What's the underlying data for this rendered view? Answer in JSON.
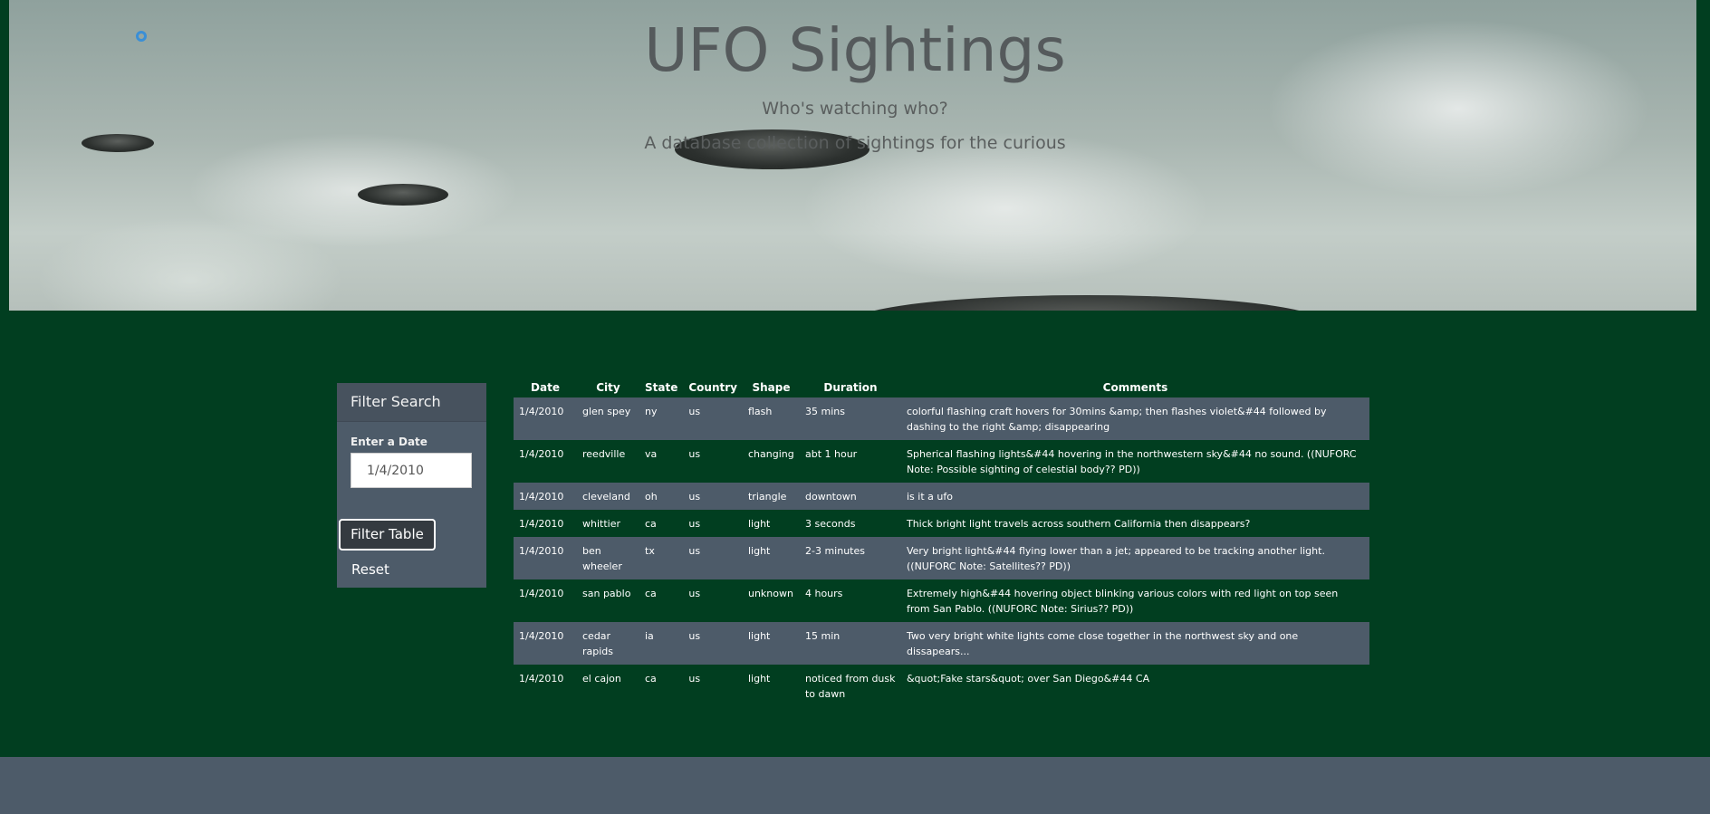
{
  "header": {
    "title": "UFO Sightings",
    "tagline": "Who's watching who?",
    "subtitle": "A database collection of sightings for the curious"
  },
  "filter": {
    "header": "Filter Search",
    "date_label": "Enter a Date",
    "date_placeholder": "1/4/2010",
    "date_value": "1/4/2010",
    "filter_button": "Filter Table",
    "reset_button": "Reset"
  },
  "table": {
    "columns": [
      "Date",
      "City",
      "State",
      "Country",
      "Shape",
      "Duration",
      "Comments"
    ],
    "rows": [
      [
        "1/4/2010",
        "glen spey",
        "ny",
        "us",
        "flash",
        "35 mins",
        "colorful flashing craft hovers for 30mins &amp; then flashes violet&#44 followed by dashing to the right &amp; disappearing"
      ],
      [
        "1/4/2010",
        "reedville",
        "va",
        "us",
        "changing",
        "abt 1 hour",
        "Spherical flashing lights&#44 hovering in the northwestern sky&#44 no sound. ((NUFORC Note: Possible sighting of celestial body?? PD))"
      ],
      [
        "1/4/2010",
        "cleveland",
        "oh",
        "us",
        "triangle",
        "downtown",
        "is it a ufo"
      ],
      [
        "1/4/2010",
        "whittier",
        "ca",
        "us",
        "light",
        "3 seconds",
        "Thick bright light travels across southern California then disappears?"
      ],
      [
        "1/4/2010",
        "ben wheeler",
        "tx",
        "us",
        "light",
        "2-3 minutes",
        "Very bright light&#44 flying lower than a jet; appeared to be tracking another light. ((NUFORC Note: Satellites?? PD))"
      ],
      [
        "1/4/2010",
        "san pablo",
        "ca",
        "us",
        "unknown",
        "4 hours",
        "Extremely high&#44 hovering object blinking various colors with red light on top seen from San Pablo. ((NUFORC Note: Sirius?? PD))"
      ],
      [
        "1/4/2010",
        "cedar rapids",
        "ia",
        "us",
        "light",
        "15 min",
        "Two very bright white lights come close together in the northwest sky and one dissapears..."
      ],
      [
        "1/4/2010",
        "el cajon",
        "ca",
        "us",
        "light",
        "noticed from dusk to dawn",
        "&quot;Fake stars&quot; over San Diego&#44 CA"
      ]
    ]
  }
}
